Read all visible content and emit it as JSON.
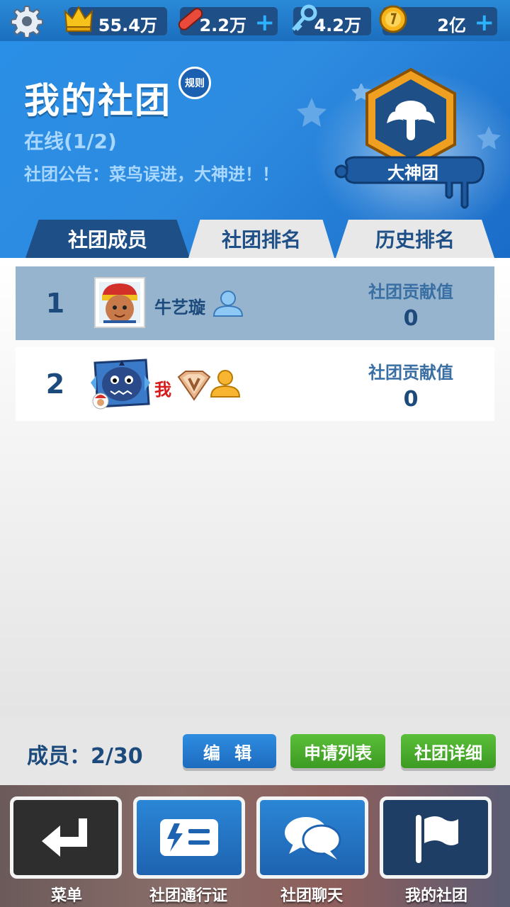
{
  "topbar": {
    "crown_value": "55.4万",
    "skateboard_value": "2.2万",
    "key_value": "4.2万",
    "coin_value": "2亿",
    "plus": "+"
  },
  "header": {
    "title": "我的社团",
    "rules": "规则",
    "online": "在线(1/2)",
    "notice": "社团公告：菜鸟误进，大神进！！",
    "crew_name": "大神团"
  },
  "tabs": [
    {
      "label": "社团成员",
      "active": true
    },
    {
      "label": "社团排名",
      "active": false
    },
    {
      "label": "历史排名",
      "active": false
    }
  ],
  "members": [
    {
      "rank": "1",
      "name": "牛艺璇",
      "contrib_label": "社团贡献值",
      "contrib": "0"
    },
    {
      "rank": "2",
      "name": "我",
      "contrib_label": "社团贡献值",
      "contrib": "0"
    }
  ],
  "actions": {
    "member_count": "成员：2/30",
    "edit": "编 辑",
    "apply_list": "申请列表",
    "details": "社团详细"
  },
  "nav": [
    {
      "label": "菜单",
      "icon": "return-icon"
    },
    {
      "label": "社团通行证",
      "icon": "pass-icon"
    },
    {
      "label": "社团聊天",
      "icon": "chat-icon"
    },
    {
      "label": "我的社团",
      "icon": "flag-icon"
    }
  ],
  "colors": {
    "accent_blue": "#1e4f86",
    "header_blue": "#2a8fe6",
    "button_green": "#4aab2c",
    "me_red": "#d81a1a"
  }
}
